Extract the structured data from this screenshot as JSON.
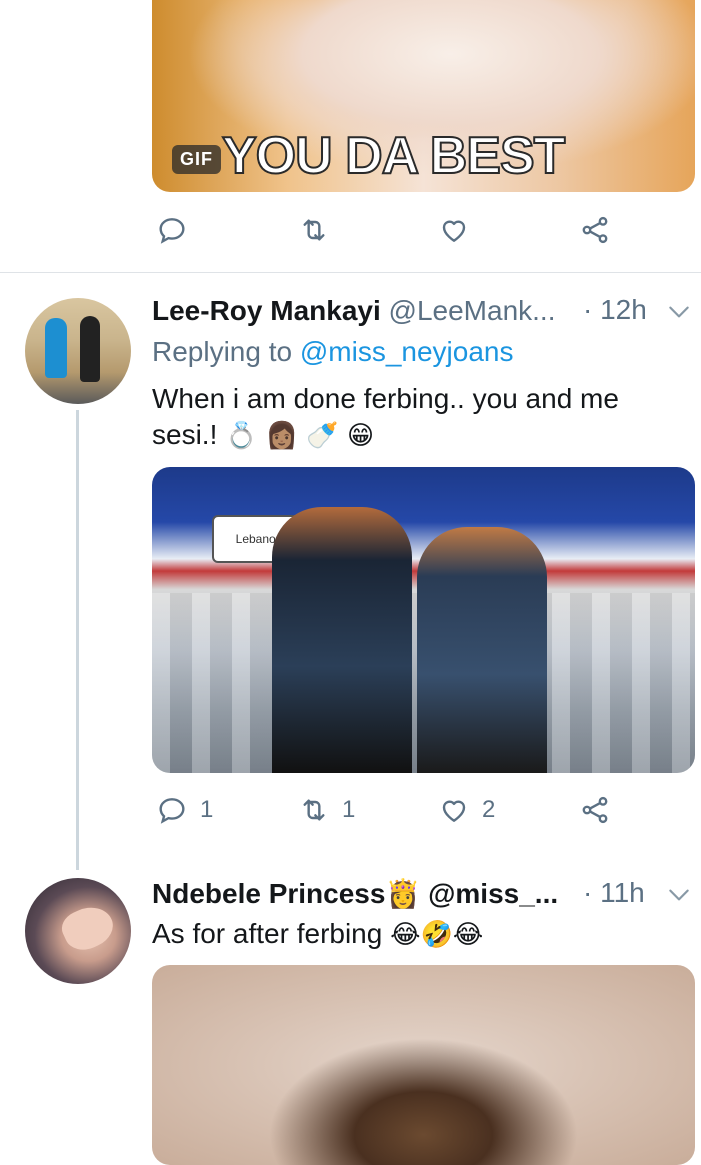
{
  "tweet0": {
    "media": {
      "caption": "YOU DA BEST",
      "badge": "GIF"
    },
    "actions": {
      "reply_count": "",
      "retweet_count": "",
      "like_count": ""
    }
  },
  "tweet1": {
    "name": "Lee-Roy Mankayi",
    "handle": "@LeeMank...",
    "time": "· 12h",
    "replying_prefix": "Replying to",
    "replying_mention": "@miss_neyjoans",
    "text": "When i am done ferbing.. you and me sesi.!",
    "emojis": "💍 👩🏽 🍼 😁",
    "photo_label": "Lebanon",
    "actions": {
      "reply_count": "1",
      "retweet_count": "1",
      "like_count": "2"
    }
  },
  "tweet2": {
    "name": "Ndebele Princess👸",
    "handle": "@miss_...",
    "time": "· 11h",
    "text": "As for after ferbing",
    "emojis": "😂🤣😂"
  },
  "colors": {
    "accent": "#1b95e0",
    "muted": "#5b7083",
    "divider": "#dfe3e7"
  },
  "icons": [
    "reply-icon",
    "retweet-icon",
    "like-icon",
    "share-icon",
    "chevron-down-icon"
  ]
}
